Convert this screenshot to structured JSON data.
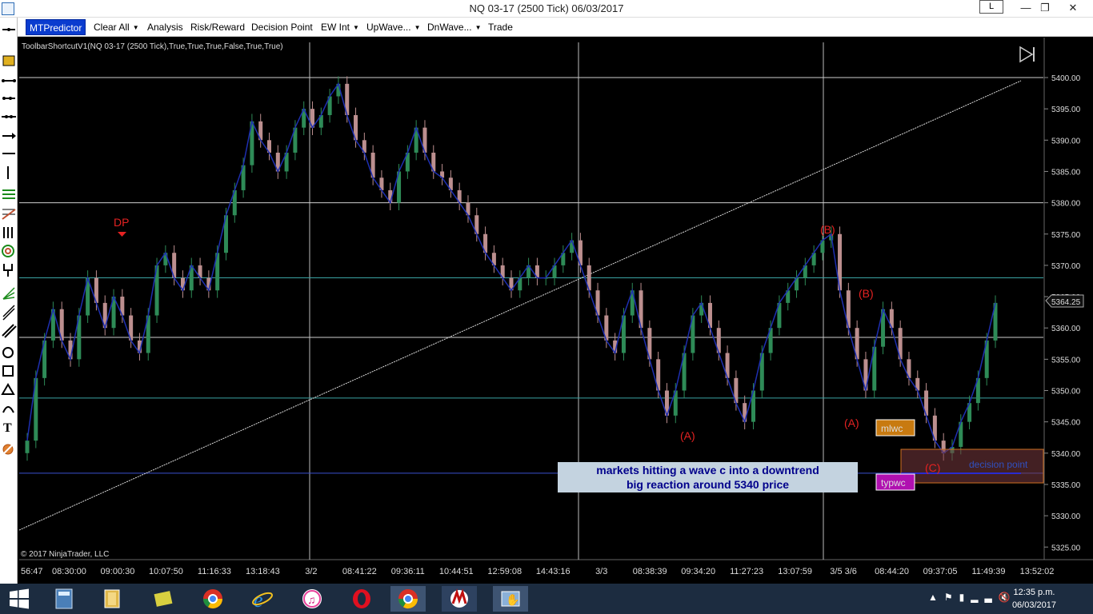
{
  "window": {
    "title": "NQ 03-17 (2500 Tick)  06/03/2017",
    "layout_button": "L",
    "min": "—",
    "max": "❐",
    "close": "✕"
  },
  "menu": {
    "mtp": "MTPredictor",
    "items": [
      "Clear All",
      "Analysis",
      "Risk/Reward",
      "Decision Point",
      "EW Int",
      "UpWave...",
      "DnWave...",
      "Trade"
    ]
  },
  "chart": {
    "indicator_label": "ToolbarShortcutV1(NQ 03-17 (2500 Tick),True,True,True,False,True,True)",
    "copyright": "© 2017 NinjaTrader, LLC",
    "price_labels": [
      "5400.00",
      "5395.00",
      "5390.00",
      "5385.00",
      "5380.00",
      "5375.00",
      "5370.00",
      "5365.00",
      "5360.00",
      "5355.00",
      "5350.00",
      "5345.00",
      "5340.00",
      "5335.00",
      "5330.00",
      "5325.00"
    ],
    "current_price": "5364.25",
    "time_labels": [
      "56:47",
      "08:30:00",
      "09:00:30",
      "10:07:50",
      "11:16:33",
      "13:18:43",
      "3/2",
      "08:41:22",
      "09:36:11",
      "10:44:51",
      "12:59:08",
      "14:43:16",
      "3/3",
      "08:38:39",
      "09:34:20",
      "11:27:23",
      "13:07:59",
      "3/5 3/6",
      "08:44:20",
      "09:37:05",
      "11:49:39",
      "13:52:02"
    ],
    "annotations": {
      "dp": "DP",
      "a1": "(A)",
      "b1": "(B)",
      "b2": "(B)",
      "a2": "(A)",
      "c": "(C)"
    },
    "boxes": {
      "mlwc": "mlwc",
      "typwc": "typwc",
      "decision_point": "decision point"
    },
    "note_line1": "markets hitting a wave c into a downtrend",
    "note_line2": "big reaction around 5340 price",
    "colors": {
      "up": "#2e8b57",
      "down": "#bc8f8f",
      "wave": "#1e2fb0",
      "hline_white": "#cfcfcf",
      "hline_teal": "#3aa3a3",
      "red": "#e52222"
    },
    "price_series": [
      5342,
      5352,
      5358,
      5363,
      5358,
      5355,
      5362,
      5368,
      5364,
      5360,
      5365,
      5362,
      5358,
      5356,
      5362,
      5370,
      5372,
      5368,
      5366,
      5370,
      5368,
      5366,
      5372,
      5378,
      5382,
      5386,
      5393,
      5390,
      5388,
      5385,
      5388,
      5392,
      5395,
      5392,
      5394,
      5397,
      5399,
      5394,
      5390,
      5388,
      5384,
      5382,
      5380,
      5385,
      5388,
      5392,
      5388,
      5385,
      5384,
      5382,
      5380,
      5378,
      5375,
      5372,
      5370,
      5368,
      5366,
      5368,
      5370,
      5368,
      5368,
      5370,
      5372,
      5374,
      5370,
      5366,
      5362,
      5358,
      5356,
      5362,
      5366,
      5360,
      5355,
      5350,
      5346,
      5350,
      5356,
      5362,
      5364,
      5360,
      5356,
      5352,
      5348,
      5345,
      5350,
      5356,
      5360,
      5364,
      5366,
      5368,
      5370,
      5372,
      5374,
      5375,
      5366,
      5360,
      5355,
      5350,
      5357,
      5363,
      5360,
      5355,
      5352,
      5350,
      5346,
      5342,
      5340,
      5341,
      5345,
      5348,
      5352,
      5358,
      5364
    ]
  },
  "taskbar": {
    "time": "12:35 p.m.",
    "date": "06/03/2017"
  }
}
